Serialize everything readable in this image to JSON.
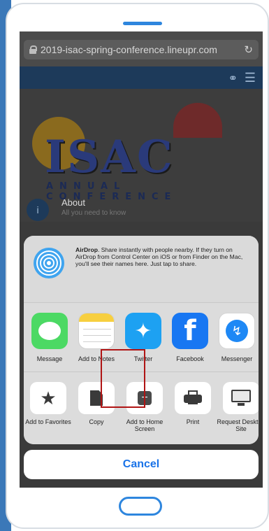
{
  "browser": {
    "url": "2019-isac-spring-conference.lineupr.com",
    "lock_icon": "lock-icon",
    "reload_icon": "reload-icon"
  },
  "site": {
    "share_icon": "share-icon",
    "menu_icon": "hamburger-menu-icon",
    "logo_text": "ISAC",
    "logo_subtitle": "ANNUAL CONFERENCE",
    "about_title": "About",
    "about_subtitle": "All you need to know",
    "about_icon_glyph": "i"
  },
  "share_sheet": {
    "airdrop": {
      "title": "AirDrop",
      "text": ". Share instantly with people nearby. If they turn on AirDrop from Control Center on iOS or from Finder on the Mac, you'll see their names here. Just tap to share."
    },
    "apps": [
      {
        "label": "Message"
      },
      {
        "label": "Add to Notes"
      },
      {
        "label": "Twitter"
      },
      {
        "label": "Facebook"
      },
      {
        "label": "Messenger"
      }
    ],
    "actions": [
      {
        "label": "Add to Favorites"
      },
      {
        "label": "Copy"
      },
      {
        "label": "Add to Home Screen"
      },
      {
        "label": "Print"
      },
      {
        "label": "Request Desktop Site"
      }
    ],
    "cancel_label": "Cancel"
  },
  "colors": {
    "highlight": "#b01414",
    "cancel_text": "#1a73e8",
    "device_accent": "#2e86de"
  }
}
